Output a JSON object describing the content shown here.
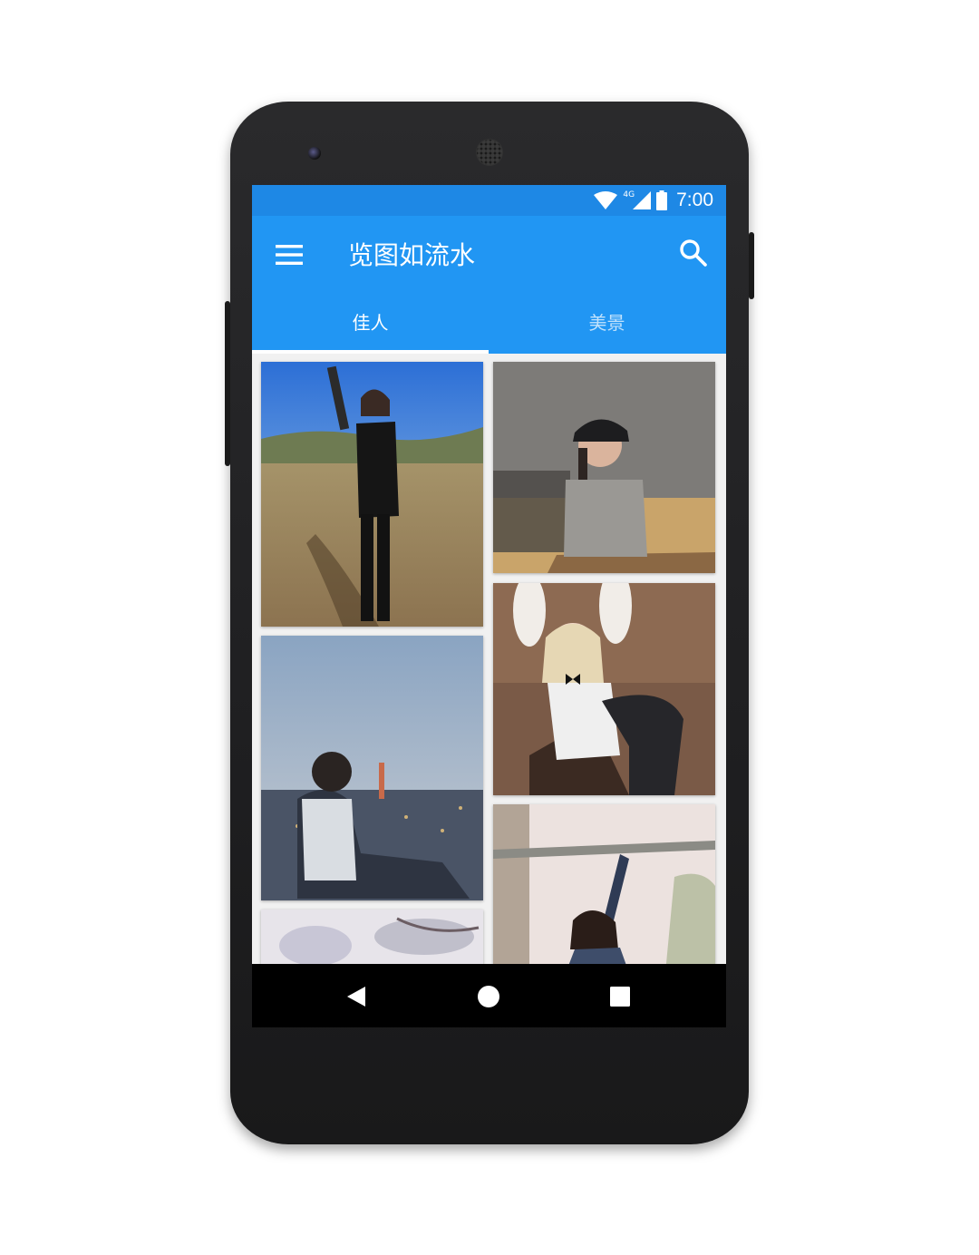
{
  "status_bar": {
    "time": "7:00",
    "network": "4G",
    "icons": [
      "wifi-icon",
      "signal-icon",
      "battery-icon"
    ]
  },
  "app_bar": {
    "title": "览图如流水",
    "menu_icon": "menu-icon",
    "search_icon": "search-icon"
  },
  "tabs": [
    {
      "label": "佳人",
      "selected": true
    },
    {
      "label": "美景",
      "selected": false
    }
  ],
  "gallery": {
    "left_column": [
      "photo-woman-hill",
      "photo-woman-city-dusk",
      "photo-blossom"
    ],
    "right_column": [
      "photo-woman-cap",
      "photo-woman-bunny",
      "photo-woman-bar"
    ]
  },
  "nav_bar": {
    "buttons": [
      "back-icon",
      "home-icon",
      "recents-icon"
    ]
  },
  "colors": {
    "primary": "#2196f3",
    "primary_dark": "#1e88e5",
    "indicator": "#ffffff"
  }
}
